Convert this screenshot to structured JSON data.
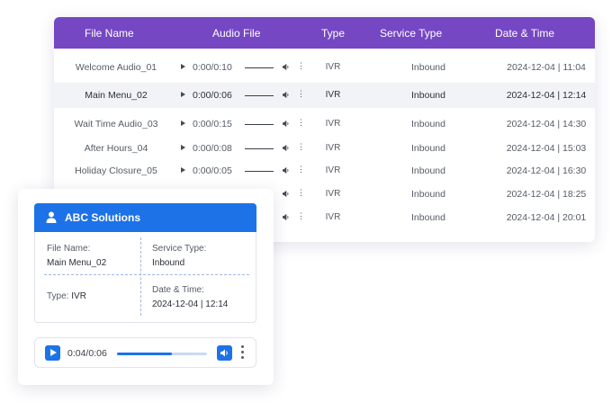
{
  "table": {
    "headers": [
      "File Name",
      "Audio File",
      "Type",
      "Service Type",
      "Date & Time"
    ],
    "rows": [
      {
        "name": "Welcome Audio_01",
        "time": "0:00/0:10",
        "type": "IVR",
        "service": "Inbound",
        "date": "2024-12-04 | 11:04",
        "selected": false
      },
      {
        "name": "Main Menu_02",
        "time": "0:00/0:06",
        "type": "IVR",
        "service": "Inbound",
        "date": "2024-12-04 | 12:14",
        "selected": true
      },
      {
        "name": "Wait Time Audio_03",
        "time": "0:00/0:15",
        "type": "IVR",
        "service": "Inbound",
        "date": "2024-12-04 | 14:30",
        "selected": false
      },
      {
        "name": "After Hours_04",
        "time": "0:00/0:08",
        "type": "IVR",
        "service": "Inbound",
        "date": "2024-12-04 | 15:03",
        "selected": false
      },
      {
        "name": "Holiday Closure_05",
        "time": "0:00/0:05",
        "type": "IVR",
        "service": "Inbound",
        "date": "2024-12-04 | 16:30",
        "selected": false
      },
      {
        "name": "",
        "time": "",
        "type": "IVR",
        "service": "Inbound",
        "date": "2024-12-04 | 18:25",
        "selected": false
      },
      {
        "name": "",
        "time": "",
        "type": "IVR",
        "service": "Inbound",
        "date": "2024-12-04 | 20:01",
        "selected": false
      }
    ],
    "icons": {
      "play": "play-icon",
      "volume": "volume-icon",
      "more": "more-vertical-icon"
    }
  },
  "detail": {
    "title": "ABC Solutions",
    "icon": "user-icon",
    "file_name_label": "File Name:",
    "file_name": "Main Menu_02",
    "service_type_label": "Service Type:",
    "service_type": "Inbound",
    "type_label": "Type:",
    "type": "IVR",
    "date_label": "Date & Time:",
    "date": "2024-12-04 | 12:14"
  },
  "player": {
    "time": "0:04/0:06",
    "progress": 0.61
  },
  "colors": {
    "header_purple": "#7547c3",
    "accent_blue": "#1d72e8",
    "selected_row": "#f2f3f6"
  }
}
